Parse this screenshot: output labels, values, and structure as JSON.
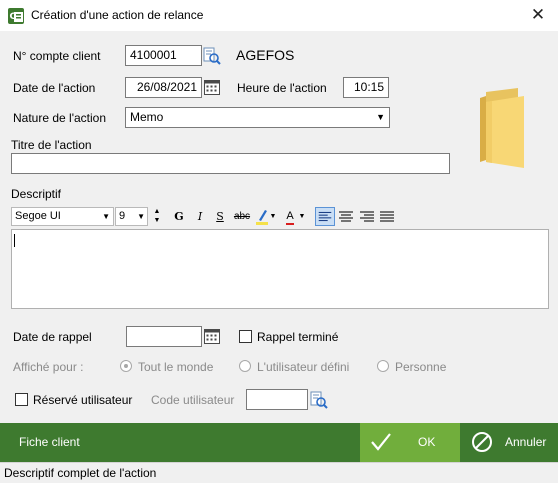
{
  "window": {
    "title": "Création d'une action de relance",
    "close_symbol": "✕"
  },
  "form": {
    "compte_label": "N° compte client",
    "compte_value": "4100001",
    "compte_name": "AGEFOS",
    "date_label": "Date de l'action",
    "date_value": "26/08/2021",
    "heure_label": "Heure de l'action",
    "heure_value": "10:15",
    "nature_label": "Nature de l'action",
    "nature_value": "Memo",
    "titre_label": "Titre de l'action",
    "titre_value": "",
    "descriptif_label": "Descriptif"
  },
  "editor_toolbar": {
    "font_name": "Segoe UI",
    "font_size": "9",
    "bold": "G",
    "italic": "I",
    "underline": "S",
    "strike": "abc",
    "font_color": "A",
    "highlight_color": "#f5e14a",
    "font_color_bar": "#d81e1e"
  },
  "rappel": {
    "date_label": "Date de rappel",
    "date_value": "",
    "termine_label": "Rappel terminé",
    "affiche_label": "Affiché pour :",
    "options": [
      "Tout le monde",
      "L'utilisateur défini",
      "Personne"
    ],
    "selected_option": "Tout le monde"
  },
  "reserve": {
    "reserve_label": "Réservé utilisateur",
    "code_label": "Code utilisateur",
    "code_value": ""
  },
  "footer": {
    "fiche_label": "Fiche client",
    "ok_label": "OK",
    "annuler_label": "Annuler"
  },
  "status": {
    "text": "Descriptif complet de l'action"
  },
  "colors": {
    "footer_dark_green": "#3e7a2f",
    "footer_ok_green": "#71ae3c",
    "folder_yellow": "#f8d775",
    "accent_blue": "#2a6cc7"
  }
}
